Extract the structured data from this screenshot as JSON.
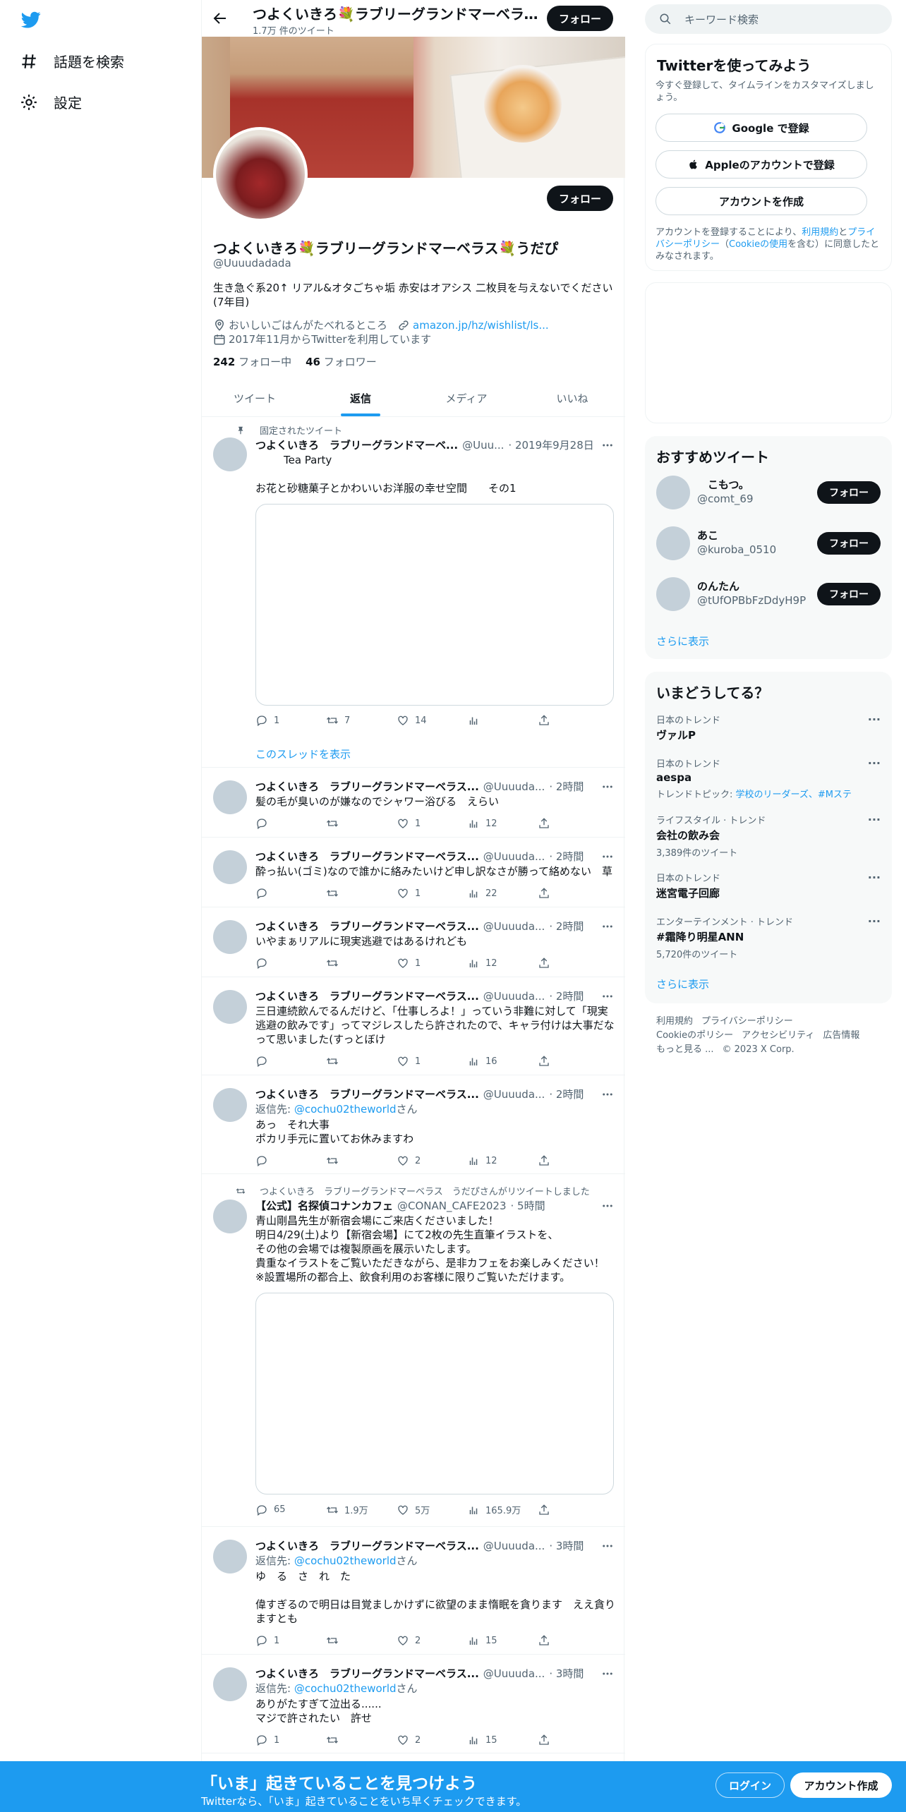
{
  "nav": {
    "items": [
      {
        "label": "話題を検索",
        "icon": "hashtag-icon"
      },
      {
        "label": "設定",
        "icon": "gear-icon"
      }
    ]
  },
  "header": {
    "name": "つよくいきろ💐ラブリーグランドマーベラス💐うだぴ",
    "tweet_count": "1.7万 件のツイート",
    "follow_label": "フォロー"
  },
  "profile": {
    "name": "つよくいきろ💐ラブリーグランドマーベラス💐うだぴ",
    "handle": "@Uuuudadada",
    "follow_label": "フォロー",
    "bio": "生き急ぐ系20↑ リアル&オタごちゃ垢 赤安はオアシス 二枚貝を与えないでください(7年目)",
    "location": "おいしいごはんがたべれるところ",
    "link": "amazon.jp/hz/wishlist/ls...",
    "joined": "2017年11月からTwitterを利用しています",
    "following_count": "242",
    "following_label": "フォロー中",
    "followers_count": "46",
    "followers_label": "フォロワー"
  },
  "tabs": [
    {
      "label": "ツイート"
    },
    {
      "label": "返信"
    },
    {
      "label": "メディア"
    },
    {
      "label": "いいね"
    }
  ],
  "pinned": {
    "context": "固定されたツイート",
    "name": "つよくいきろ　ラブリーグランドマーベ...",
    "handle": "@Uuu...",
    "time": "· 2019年9月28日",
    "subtitle": "Tea Party",
    "text": "お花と砂糖菓子とかわいいお洋服の幸せ空間　　その1",
    "replies": "1",
    "retweets": "7",
    "likes": "14",
    "thread_link": "このスレッドを表示"
  },
  "tweets": [
    {
      "name": "つよくいきろ　ラブリーグランドマーベラス...",
      "handle": "@Uuuuda...",
      "time": "· 2時間",
      "reply_to": "",
      "reply_prefix": "",
      "reply_suffix": "",
      "text": "髪の毛が臭いのが嫌なのでシャワー浴びる　えらい",
      "replies": "",
      "retweets": "",
      "likes": "1",
      "views": "12"
    },
    {
      "name": "つよくいきろ　ラブリーグランドマーベラス...",
      "handle": "@Uuuuda...",
      "time": "· 2時間",
      "reply_to": "",
      "reply_prefix": "",
      "reply_suffix": "",
      "text": "酔っ払い(ゴミ)なので誰かに絡みたいけど申し訳なさが勝って絡めない　草",
      "replies": "",
      "retweets": "",
      "likes": "1",
      "views": "22"
    },
    {
      "name": "つよくいきろ　ラブリーグランドマーベラス...",
      "handle": "@Uuuuda...",
      "time": "· 2時間",
      "reply_to": "",
      "reply_prefix": "",
      "reply_suffix": "",
      "text": "いやまぁリアルに現実逃避ではあるけれども",
      "replies": "",
      "retweets": "",
      "likes": "1",
      "views": "12"
    },
    {
      "name": "つよくいきろ　ラブリーグランドマーベラス...",
      "handle": "@Uuuuda...",
      "time": "· 2時間",
      "reply_to": "",
      "reply_prefix": "",
      "reply_suffix": "",
      "text": "三日連続飲んでるんだけど、「仕事しろよ！」っていう非難に対して「現実逃避の飲みです」ってマジレスしたら許されたので、キャラ付けは大事だなって思いました(すっとぼけ",
      "replies": "",
      "retweets": "",
      "likes": "1",
      "views": "16"
    },
    {
      "name": "つよくいきろ　ラブリーグランドマーベラス...",
      "handle": "@Uuuuda...",
      "time": "· 2時間",
      "reply_prefix": "返信先: ",
      "reply_to": "@cochu02theworld",
      "reply_suffix": "さん",
      "text": "あっ　それ大事\nポカリ手元に置いてお休みますわ",
      "replies": "",
      "retweets": "",
      "likes": "2",
      "views": "12"
    }
  ],
  "retweet": {
    "context": "つよくいきろ　ラブリーグランドマーベラス　うだぴさんがリツイートしました",
    "name": "【公式】名探偵コナンカフェ",
    "handle": "@CONAN_CAFE2023",
    "time": "· 5時間",
    "text": "青山剛昌先生が新宿会場にご来店くださいました！\n明日4/29(土)より【新宿会場】にて2枚の先生直筆イラストを、\nその他の会場では複製原画を展示いたします。\n貴重なイラストをご覧いただきながら、是非カフェをお楽しみください！\n※設置場所の都合上、飲食利用のお客様に限りご覧いただけます。",
    "replies": "65",
    "retweets": "1.9万",
    "likes": "5万",
    "views": "165.9万"
  },
  "tweets2": [
    {
      "name": "つよくいきろ　ラブリーグランドマーベラス...",
      "handle": "@Uuuuda...",
      "time": "· 3時間",
      "reply_prefix": "返信先: ",
      "reply_to": "@cochu02theworld",
      "reply_suffix": "さん",
      "text": "ゆ　る　さ　れ　た\n\n偉すぎるので明日は目覚ましかけずに欲望のまま惰眠を貪ります　ええ貪りますとも",
      "replies": "1",
      "retweets": "",
      "likes": "2",
      "views": "15"
    },
    {
      "name": "つよくいきろ　ラブリーグランドマーベラス...",
      "handle": "@Uuuuda...",
      "time": "· 3時間",
      "reply_prefix": "返信先: ",
      "reply_to": "@cochu02theworld",
      "reply_suffix": "さん",
      "text": "ありがたすぎて泣出る......\nマジで許されたい　許せ",
      "replies": "1",
      "retweets": "",
      "likes": "2",
      "views": "15"
    }
  ],
  "search": {
    "placeholder": "キーワード検索"
  },
  "signup_card": {
    "title": "Twitterを使ってみよう",
    "subtitle": "今すぐ登録して、タイムラインをカスタマイズしましょう。",
    "google": "Google で登録",
    "apple": "Appleのアカウントで登録",
    "create": "アカウントを作成",
    "terms_prefix": "アカウントを登録することにより、",
    "terms_link1": "利用規約",
    "terms_mid1": "と",
    "terms_link2": "プライバシーポリシー",
    "terms_mid2": "（",
    "terms_link3": "Cookieの使用",
    "terms_suffix": "を含む）に同意したとみなされます。"
  },
  "recommend": {
    "title": "おすすめツイート",
    "users": [
      {
        "name": "　こもつ。",
        "handle": "@comt_69",
        "button": "フォロー"
      },
      {
        "name": "あこ",
        "handle": "@kuroba_0510",
        "button": "フォロー"
      },
      {
        "name": "のんたん",
        "handle": "@tUfOPBbFzDdyH9P",
        "button": "フォロー"
      }
    ],
    "show_more": "さらに表示"
  },
  "trends": {
    "title": "いまどうしてる？",
    "items": [
      {
        "category": "日本のトレンド",
        "title": "ヴァルP",
        "sub": "",
        "sub_links": ""
      },
      {
        "category": "日本のトレンド",
        "title": "aespa",
        "sub": "トレンドトピック: ",
        "sub_links": "学校のリーダーズ、#Mステ"
      },
      {
        "category": "ライフスタイル · トレンド",
        "title": "会社の飲み会",
        "sub": "3,389件のツイート",
        "sub_links": ""
      },
      {
        "category": "日本のトレンド",
        "title": "迷宮電子回廊",
        "sub": "",
        "sub_links": ""
      },
      {
        "category": "エンターテインメント · トレンド",
        "title": "#霜降り明星ANN",
        "sub": "5,720件のツイート",
        "sub_links": ""
      }
    ],
    "show_more": "さらに表示"
  },
  "footer": {
    "links": [
      "利用規約",
      "プライバシーポリシー",
      "Cookieのポリシー",
      "アクセシビリティ",
      "広告情報",
      "もっと見る ...",
      "© 2023 X Corp."
    ]
  },
  "bottom_bar": {
    "title": "「いま」起きていることを見つけよう",
    "subtitle": "Twitterなら、「いま」起きていることをいち早くチェックできます。",
    "login": "ログイン",
    "signup": "アカウント作成"
  },
  "colors": {
    "accent": "#1d9bf0",
    "text": "#0f1419",
    "muted": "#536471",
    "button_dark": "#0f1419"
  }
}
